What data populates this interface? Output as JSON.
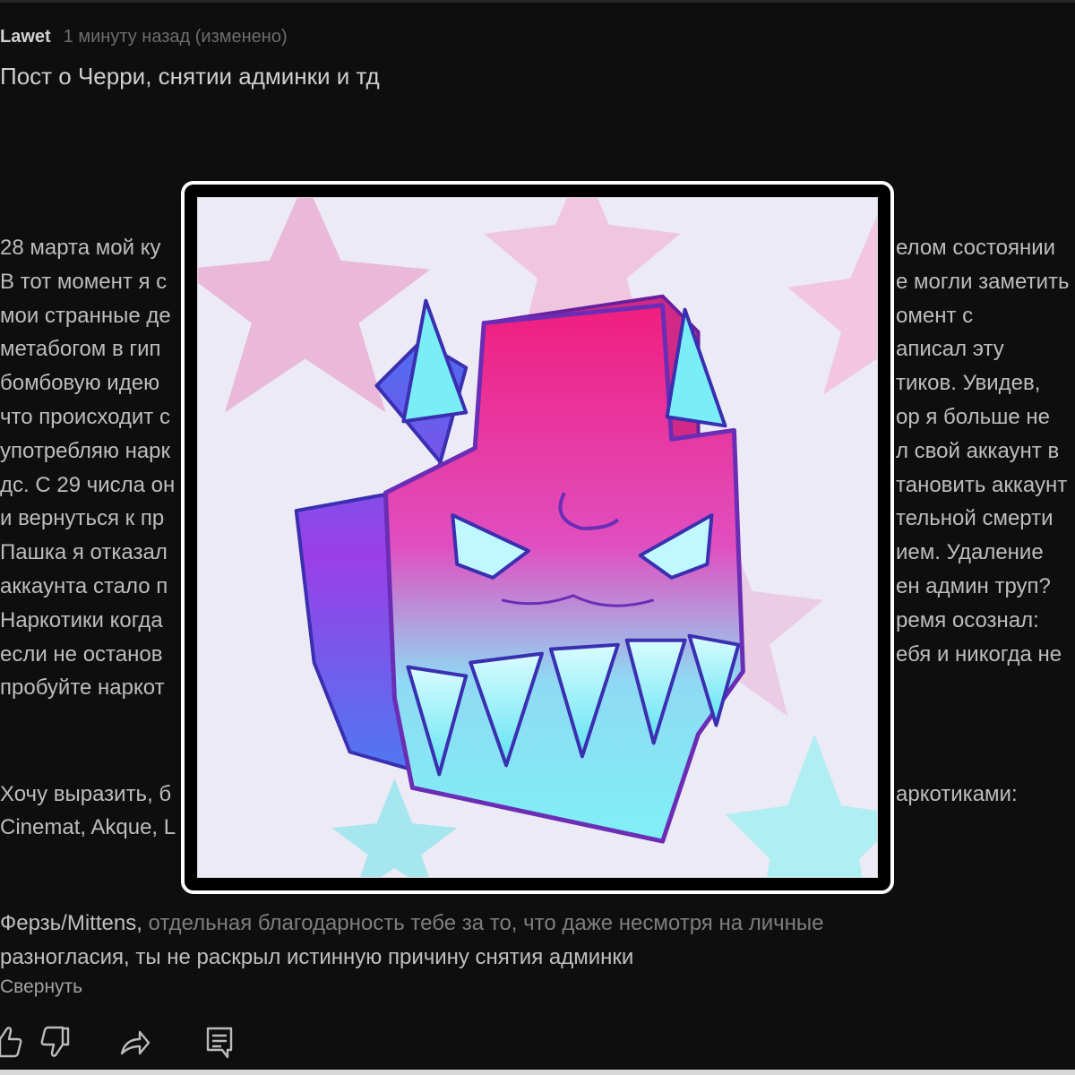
{
  "post": {
    "author": "Lawet",
    "timestamp": "1 минуту назад (изменено)",
    "title": "Пост о Черри, снятии админки и тд",
    "body_lines": [
      "28 марта мой ку",
      "В тот момент я с",
      "мои странные де",
      "метабогом в гип",
      "бомбовую идею",
      "что происходит с",
      "употребляю нарк",
      "дс. С 29 числа он",
      "и вернуться к пр",
      "Пашка я отказал",
      "аккаунта стало п",
      "Наркотики когда",
      "если не останов",
      "пробуйте наркот"
    ],
    "body_right_lines": [
      "елом состоянии",
      "е могли заметить",
      "омент с",
      "аписал эту",
      "тиков. Увидев,",
      "ор я больше не",
      "л свой аккаунт в",
      "тановить аккаунт",
      "тельной смерти",
      "ием. Удаление",
      "ен админ труп?",
      "ремя осознал:",
      "ебя и никогда не",
      ""
    ],
    "thanks_lines": [
      "Хочу выразить, б",
      "Cinemat, Akque, L"
    ],
    "thanks_right": [
      "аркотиками:",
      ""
    ],
    "reply_name": "Ферзь/Mittens,",
    "reply_rest_1": " отдельная благодарность тебе за то, что даже несмотря на личные",
    "reply_line_2": "разногласия, ты не раскрыл истинную причину снятия админки",
    "collapse_label": "Свернуть"
  },
  "actions": {
    "like": "thumb-up-icon",
    "dislike": "thumb-down-icon",
    "share": "share-icon",
    "reply": "comment-icon"
  },
  "colors": {
    "background": "#0e0e0e",
    "text": "#bdbdbd",
    "muted": "#6d6d6d",
    "modal_frame": "#ffffff",
    "art_pink": "#f0307f",
    "art_cyan": "#7ff0f4",
    "art_blue": "#4d6ef0"
  }
}
